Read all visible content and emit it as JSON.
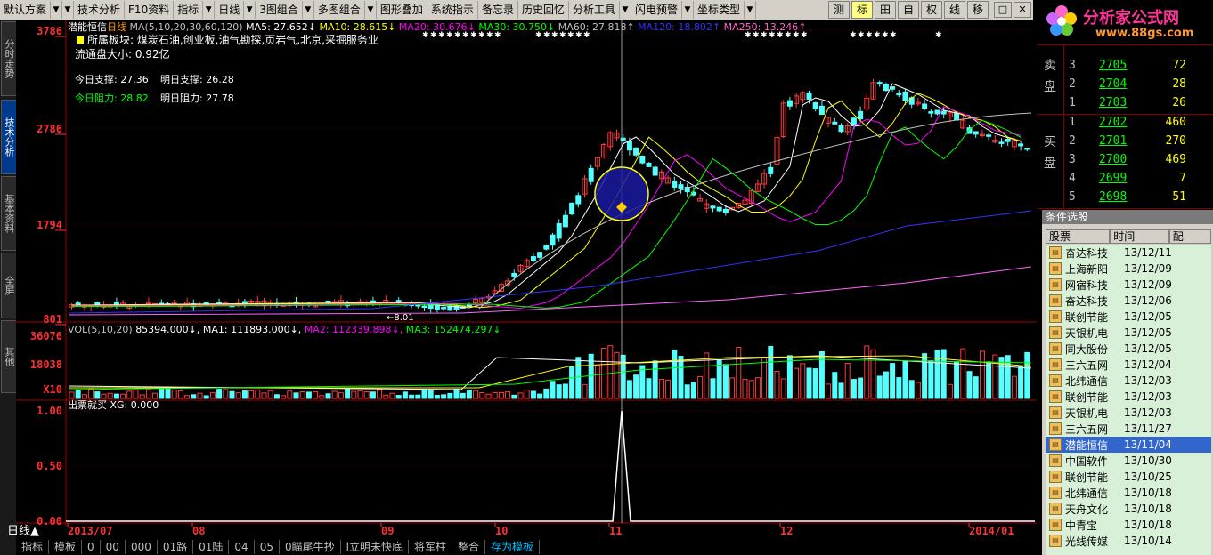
{
  "menu": {
    "items": [
      "默认方案",
      "技术分析",
      "F10资料",
      "指标",
      "日线",
      "3图组合",
      "多图组合",
      "图形叠加",
      "系统指示",
      "备忘录",
      "历史回忆",
      "分析工具",
      "闪电预警",
      "坐标类型"
    ],
    "tools": [
      "测",
      "标",
      "田",
      "自",
      "权",
      "线",
      "移"
    ],
    "win_buttons": [
      "□",
      "✕"
    ]
  },
  "left_tabs": [
    "分时走势",
    "技术分析",
    "基本资料",
    "全屏",
    "其他"
  ],
  "chart": {
    "title": "潜能恒信",
    "period": "日线",
    "ma_text": "MA(5,10,20,30,60,120)",
    "ma5": "MA5: 27.652↓",
    "ma10": "MA10: 28.615↓",
    "ma20": "MA20: 30.676↓",
    "ma30": "MA30: 30.750↓",
    "ma60": "MA60: 27.818↑",
    "ma120": "MA120: 18.802↑",
    "ma250": "MA250: 13.246↑",
    "info_sector": "所属板块: 煤炭石油,创业板,油气勘探,页岩气,北京,采掘服务业",
    "info_float": "流通盘大小: 0.92亿",
    "support_today": "今日支撑: 27.36",
    "support_tomorrow": "明日支撑: 26.28",
    "resist_today": "今日阻力: 28.82",
    "resist_tomorrow": "明日阻力: 27.78",
    "low_marker": "←8.01",
    "y_labels": [
      "3786",
      "2786",
      "1794",
      "801"
    ],
    "vol_text": "VOL(5,10,20)",
    "vol_val": "85394.000↓",
    "vol_ma1": "MA1: 111893.000↓",
    "vol_ma2": "MA2: 112339.898↓",
    "vol_ma3": "MA3: 152474.297↓",
    "vol_y": [
      "36076",
      "18038",
      "X10"
    ],
    "ind_title": "出票就买",
    "ind_val": "XG: 0.000",
    "ind_y": [
      "1.00",
      "0.50",
      "0.00"
    ],
    "dates": [
      "2013/07",
      "08",
      "09",
      "10",
      "11",
      "12",
      "2014/01"
    ]
  },
  "orderbook": {
    "sell_label": [
      "卖",
      "盘"
    ],
    "buy_label": [
      "买",
      "盘"
    ],
    "sells": [
      {
        "n": "3",
        "p": "2705",
        "v": "72"
      },
      {
        "n": "2",
        "p": "2704",
        "v": "28"
      },
      {
        "n": "1",
        "p": "2703",
        "v": "26"
      }
    ],
    "buys": [
      {
        "n": "1",
        "p": "2702",
        "v": "460"
      },
      {
        "n": "2",
        "p": "2701",
        "v": "270"
      },
      {
        "n": "3",
        "p": "2700",
        "v": "469"
      },
      {
        "n": "4",
        "p": "2699",
        "v": "7"
      },
      {
        "n": "5",
        "p": "2698",
        "v": "51"
      }
    ]
  },
  "logo": {
    "text": "分析家公式网",
    "url": "www.88gs.com"
  },
  "stock_panel": {
    "title": "条件选股",
    "headers": [
      "股票",
      "时间",
      "配"
    ],
    "rows": [
      {
        "name": "奋达科技",
        "date": "13/12/11"
      },
      {
        "name": "上海新阳",
        "date": "13/12/09"
      },
      {
        "name": "网宿科技",
        "date": "13/12/09"
      },
      {
        "name": "奋达科技",
        "date": "13/12/06"
      },
      {
        "name": "联创节能",
        "date": "13/12/05"
      },
      {
        "name": "天银机电",
        "date": "13/12/05"
      },
      {
        "name": "同大股份",
        "date": "13/12/05"
      },
      {
        "name": "三六五网",
        "date": "13/12/04"
      },
      {
        "name": "北纬通信",
        "date": "13/12/03"
      },
      {
        "name": "联创节能",
        "date": "13/12/03"
      },
      {
        "name": "天银机电",
        "date": "13/12/03"
      },
      {
        "name": "三六五网",
        "date": "13/11/27"
      },
      {
        "name": "潜能恒信",
        "date": "13/11/04",
        "selected": true
      },
      {
        "name": "中国软件",
        "date": "13/10/30"
      },
      {
        "name": "联创节能",
        "date": "13/10/25"
      },
      {
        "name": "北纬通信",
        "date": "13/10/18"
      },
      {
        "name": "天舟文化",
        "date": "13/10/18"
      },
      {
        "name": "中青宝",
        "date": "13/10/18"
      },
      {
        "name": "光线传媒",
        "date": "13/10/14"
      }
    ]
  },
  "bottom": {
    "period_label": "日线▲",
    "tabs": [
      "指标",
      "模板",
      "0",
      "00",
      "000",
      "01路",
      "01陆",
      "04",
      "05",
      "0瞄尾牛抄",
      "l立明未快底",
      "将军柱",
      "整合",
      "存为模板"
    ]
  }
}
